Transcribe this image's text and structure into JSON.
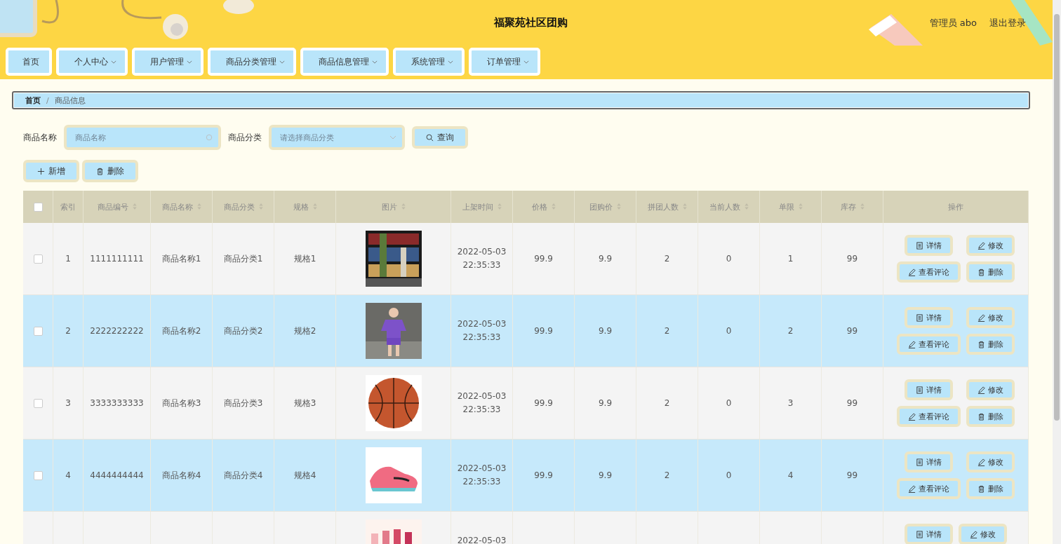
{
  "header": {
    "title": "福聚苑社区团购",
    "user": "管理员 abo",
    "logout": "退出登录"
  },
  "nav": [
    {
      "label": "首页",
      "dropdown": false
    },
    {
      "label": "个人中心",
      "dropdown": true
    },
    {
      "label": "用户管理",
      "dropdown": true
    },
    {
      "label": "商品分类管理",
      "dropdown": true
    },
    {
      "label": "商品信息管理",
      "dropdown": true
    },
    {
      "label": "系统管理",
      "dropdown": true
    },
    {
      "label": "订单管理",
      "dropdown": true
    }
  ],
  "breadcrumb": {
    "items": [
      "首页",
      "商品信息"
    ],
    "separator": "/"
  },
  "search": {
    "name_label": "商品名称",
    "name_placeholder": "商品名称",
    "category_label": "商品分类",
    "category_placeholder": "请选择商品分类",
    "query": "查询"
  },
  "actions": {
    "add": "新增",
    "delete": "删除"
  },
  "table": {
    "all_checked": false,
    "columns": [
      {
        "label": "索引",
        "sortable": false
      },
      {
        "label": "商品编号",
        "sortable": true
      },
      {
        "label": "商品名称",
        "sortable": true
      },
      {
        "label": "商品分类",
        "sortable": true
      },
      {
        "label": "规格",
        "sortable": true
      },
      {
        "label": "图片",
        "sortable": true
      },
      {
        "label": "上架时间",
        "sortable": true
      },
      {
        "label": "价格",
        "sortable": true
      },
      {
        "label": "团购价",
        "sortable": true
      },
      {
        "label": "拼团人数",
        "sortable": true
      },
      {
        "label": "当前人数",
        "sortable": true
      },
      {
        "label": "单限",
        "sortable": true
      },
      {
        "label": "库存",
        "sortable": true
      },
      {
        "label": "操作",
        "sortable": false
      }
    ],
    "rows": [
      {
        "checked": false,
        "index": "1",
        "code": "1111111111",
        "name": "商品名称1",
        "category": "商品分类1",
        "spec": "规格1",
        "image": {
          "kind": "books"
        },
        "date": "2022-05-03",
        "time": "22:35:33",
        "price": "99.9",
        "group_price": "9.9",
        "group_size": "2",
        "current": "0",
        "limit": "1",
        "stock": "99",
        "buttons": [
          "详情",
          "修改",
          "查看评论",
          "删除"
        ]
      },
      {
        "checked": false,
        "index": "2",
        "code": "2222222222",
        "name": "商品名称2",
        "category": "商品分类2",
        "spec": "规格2",
        "image": {
          "kind": "clothes"
        },
        "date": "2022-05-03",
        "time": "22:35:33",
        "price": "99.9",
        "group_price": "9.9",
        "group_size": "2",
        "current": "0",
        "limit": "2",
        "stock": "99",
        "buttons": [
          "详情",
          "修改",
          "查看评论",
          "删除"
        ]
      },
      {
        "checked": false,
        "index": "3",
        "code": "3333333333",
        "name": "商品名称3",
        "category": "商品分类3",
        "spec": "规格3",
        "image": {
          "kind": "ball"
        },
        "date": "2022-05-03",
        "time": "22:35:33",
        "price": "99.9",
        "group_price": "9.9",
        "group_size": "2",
        "current": "0",
        "limit": "3",
        "stock": "99",
        "buttons": [
          "详情",
          "修改",
          "查看评论",
          "删除"
        ]
      },
      {
        "checked": false,
        "index": "4",
        "code": "4444444444",
        "name": "商品名称4",
        "category": "商品分类4",
        "spec": "规格4",
        "image": {
          "kind": "shoes"
        },
        "date": "2022-05-03",
        "time": "22:35:33",
        "price": "99.9",
        "group_price": "9.9",
        "group_size": "2",
        "current": "0",
        "limit": "4",
        "stock": "99",
        "buttons": [
          "详情",
          "修改",
          "查看评论",
          "删除"
        ]
      },
      {
        "image": {
          "kind": "lipstick"
        },
        "date": "2022-05-03",
        "buttons": [
          "详情",
          "修改"
        ]
      }
    ]
  }
}
